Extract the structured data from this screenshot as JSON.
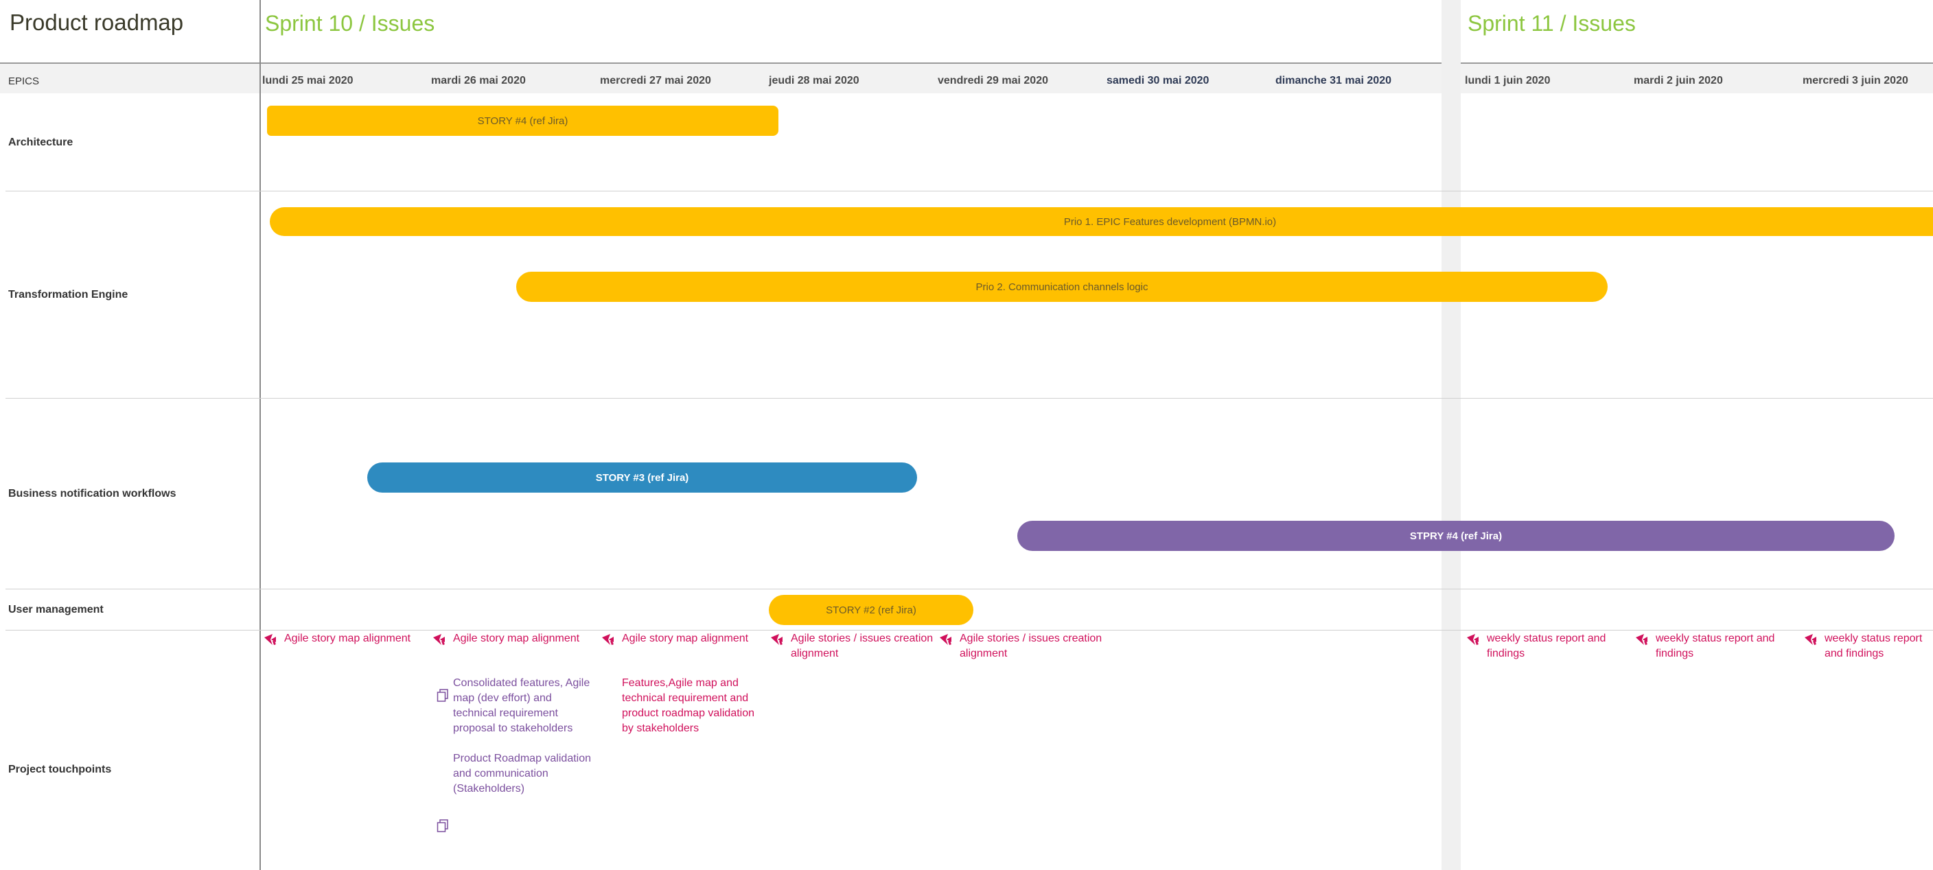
{
  "app": {
    "title": "Product roadmap"
  },
  "sprints": [
    "Sprint 10 / Issues",
    "Sprint 11 / Issues"
  ],
  "header": {
    "epics_label": "EPICS",
    "dates": [
      "lundi 25 mai 2020",
      "mardi 26 mai 2020",
      "mercredi 27 mai 2020",
      "jeudi 28 mai 2020",
      "vendredi 29 mai 2020",
      "samedi 30 mai 2020",
      "dimanche 31 mai 2020",
      "lundi 1 juin 2020",
      "mardi 2 juin 2020",
      "mercredi 3 juin 2020"
    ]
  },
  "rows": [
    "Architecture",
    "Transformation Engine",
    "Business notification workflows",
    "User management",
    "Project touchpoints"
  ],
  "bars": [
    {
      "label": "STORY #4 (ref Jira)",
      "color": "#ffc000"
    },
    {
      "label": "Prio 1. EPIC Features development (BPMN.io)",
      "color": "#ffc000"
    },
    {
      "label": "Prio 2. Communication channels logic",
      "color": "#ffc000"
    },
    {
      "label": "STORY #3 (ref Jira)",
      "color": "#2e8bc0"
    },
    {
      "label": "STPRY #4 (ref Jira)",
      "color": "#8066a8"
    },
    {
      "label": "STORY #2 (ref Jira)",
      "color": "#ffc000"
    }
  ],
  "touchpoints": [
    {
      "text": "Agile story map alignment",
      "icon": "megaphone-icon"
    },
    {
      "text": "Agile story map alignment",
      "icon": "megaphone-icon"
    },
    {
      "text": "Agile story map alignment",
      "icon": "megaphone-icon"
    },
    {
      "text": "Agile stories / issues creation alignment",
      "icon": "megaphone-icon"
    },
    {
      "text": "Agile stories / issues creation alignment",
      "icon": "megaphone-icon"
    },
    {
      "text": "weekly status report and findings",
      "icon": "megaphone-icon"
    },
    {
      "text": "weekly status report and findings",
      "icon": "megaphone-icon"
    },
    {
      "text": "weekly status report and findings",
      "icon": "megaphone-icon"
    }
  ],
  "notes": [
    {
      "text": "Consolidated features, Agile map (dev effort) and technical requirement proposal to stakeholders",
      "icon": "document-copy-icon"
    },
    {
      "text": "Features,Agile map and technical requirement and product roadmap validation by stakeholders"
    },
    {
      "text": "Product Roadmap validation and communication (Stakeholders)"
    },
    {
      "icon": "document-copy-icon"
    }
  ],
  "colors": {
    "sprint": "#8cc63f",
    "touchpoint": "#d0105b",
    "note_purple": "#7b4f9e"
  }
}
